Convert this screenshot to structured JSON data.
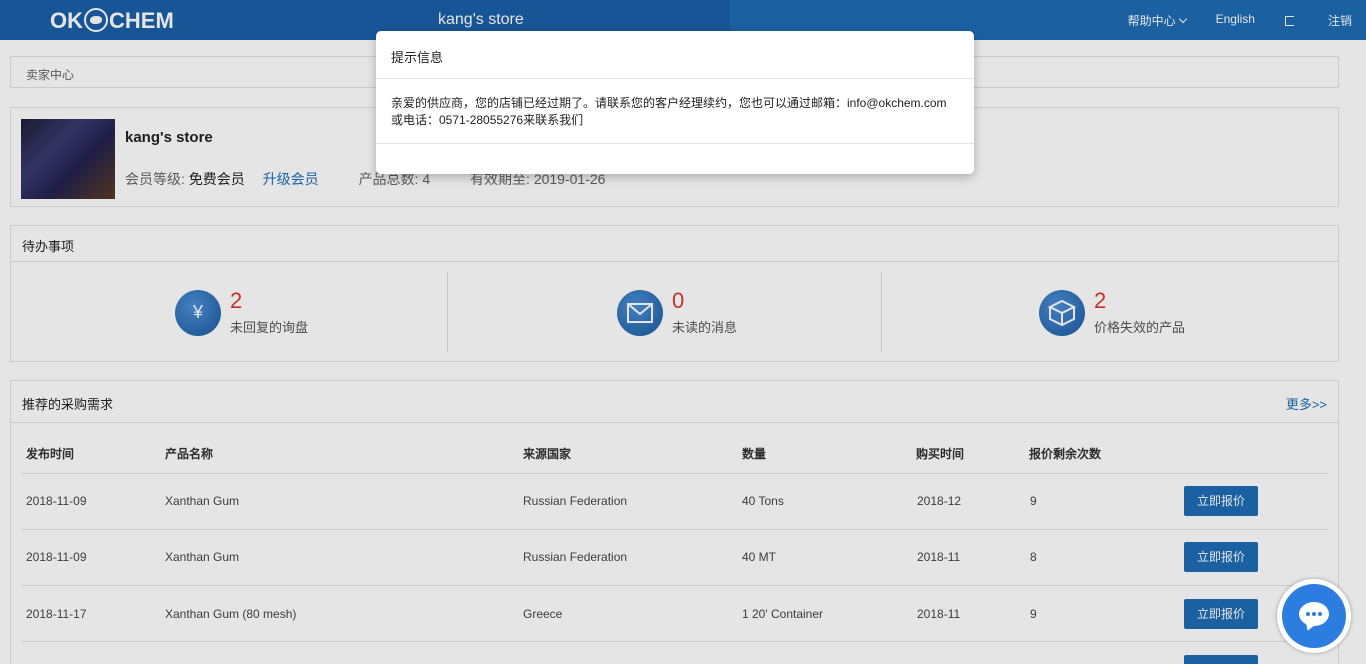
{
  "header": {
    "logo_text_left": "OK",
    "logo_text_right": "CHEM",
    "store_title": "kang's store",
    "help_center": "帮助中心",
    "language": "English",
    "logout": "注销"
  },
  "breadcrumb": "卖家中心",
  "profile": {
    "store_name": "kang's store",
    "level_label": "会员等级:",
    "level_value": "免费会员",
    "upgrade": "升级会员",
    "product_total_label": "产品总数:",
    "product_total_value": "4",
    "expiry_label": "有效期至:",
    "expiry_value": "2019-01-26"
  },
  "todo": {
    "title": "待办事项",
    "items": [
      {
        "count": "2",
        "label": "未回复的询盘",
        "icon": "yen-chat-icon"
      },
      {
        "count": "0",
        "label": "未读的消息",
        "icon": "envelope-icon"
      },
      {
        "count": "2",
        "label": "价格失效的产品",
        "icon": "box-icon"
      }
    ]
  },
  "recommend": {
    "title": "推荐的采购需求",
    "more": "更多>>",
    "columns": [
      "发布时间",
      "产品名称",
      "来源国家",
      "数量",
      "购买时间",
      "报价剩余次数"
    ],
    "button_label": "立即报价",
    "rows": [
      [
        "2018-11-09",
        "Xanthan Gum",
        "Russian Federation",
        "40 Tons",
        "2018-12",
        "9"
      ],
      [
        "2018-11-09",
        "Xanthan Gum",
        "Russian Federation",
        "40 MT",
        "2018-11",
        "8"
      ],
      [
        "2018-11-17",
        "Xanthan Gum (80 mesh)",
        "Greece",
        "1 20' Container",
        "2018-11",
        "9"
      ]
    ]
  },
  "modal": {
    "title": "提示信息",
    "line1": "亲爱的供应商，您的店铺已经过期了。请联系您的客户经理续约，您也可以通过邮箱：info@okchem.com",
    "line2": "或电话：0571-28055276来联系我们"
  },
  "colors": {
    "brand_blue": "#1f6db5",
    "count_red": "#d9382e",
    "chat_blue": "#2b7de0"
  }
}
